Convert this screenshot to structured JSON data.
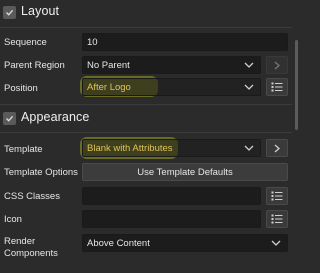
{
  "layout": {
    "title": "Layout",
    "sequence": {
      "label": "Sequence",
      "value": "10"
    },
    "parent_region": {
      "label": "Parent Region",
      "value": "No Parent"
    },
    "position": {
      "label": "Position",
      "value": "After Logo"
    }
  },
  "appearance": {
    "title": "Appearance",
    "template": {
      "label": "Template",
      "value": "Blank with Attributes"
    },
    "template_options": {
      "label": "Template Options",
      "button": "Use Template Defaults"
    },
    "css_classes": {
      "label": "CSS Classes",
      "value": ""
    },
    "icon": {
      "label": "Icon",
      "value": ""
    },
    "render_components": {
      "label_line1": "Render",
      "label_line2": "Components",
      "value": "Above Content"
    }
  },
  "colors": {
    "highlight": "#e8f014",
    "panel": "#2b2b2b",
    "field": "#1c1c1c"
  },
  "icons": [
    "checkmark-icon",
    "chevron-down-icon",
    "chevron-right-icon",
    "list-picker-icon"
  ]
}
